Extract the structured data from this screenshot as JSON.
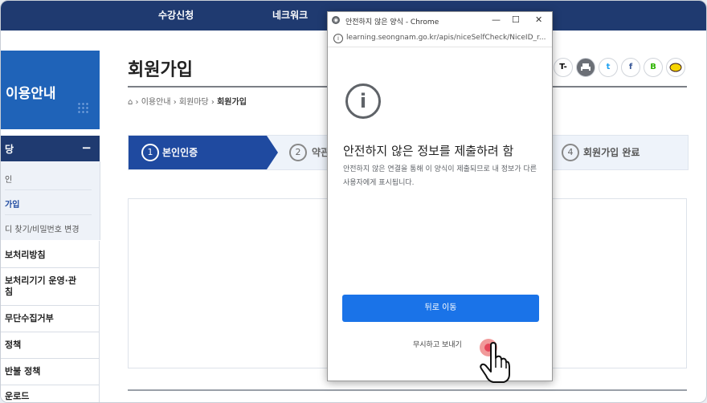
{
  "topnav": {
    "items": [
      "수강신청",
      "네크워크"
    ]
  },
  "sidebar": {
    "banner_title": "이용안내",
    "section_title": "당",
    "section_toggle": "−",
    "submenu": [
      "인",
      "가입",
      "디 찾기/비밀번호 변경"
    ],
    "items": [
      "보처리방침",
      "보처리기기 운영·관\n침",
      "무단수집거부",
      "정책",
      "반불 정책",
      "운로드"
    ]
  },
  "main": {
    "title": "회원가입",
    "breadcrumb": [
      "이용안내",
      "회원마당",
      "회원가입"
    ],
    "social": [
      "T-",
      "",
      "t",
      "f",
      "B",
      ""
    ],
    "steps": [
      {
        "num": "1",
        "label": "본인인증"
      },
      {
        "num": "2",
        "label": "약관"
      },
      {
        "num": "4",
        "label": "회원가입 완료"
      }
    ]
  },
  "popup": {
    "window_title": "안전하지 않은 양식 - Chrome",
    "url": "learning.seongnam.go.kr/apis/niceSelfCheck/NiceID_r...",
    "heading": "안전하지 않은 정보를 제출하려 함",
    "body": "안전하지 않은 연결을 통해 이 양식이 제출되므로 내 정보가 다른 사용자에게 표시됩니다.",
    "back_button": "뒤로 이동",
    "ignore_link": "무시하고 보내기",
    "icon_glyph": "i"
  },
  "colors": {
    "navy": "#1f3a70",
    "blue": "#1f4aa0",
    "chrome_button": "#1a73e8"
  }
}
